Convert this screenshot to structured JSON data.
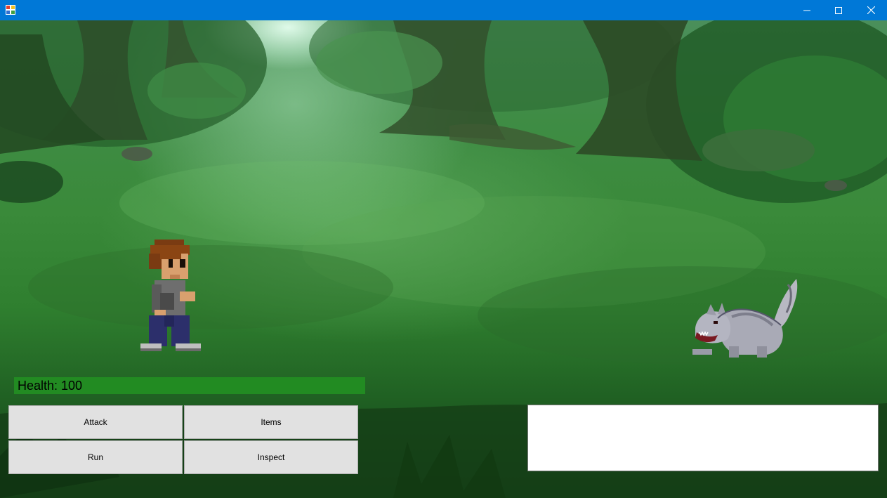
{
  "window": {
    "icon": "app-icon",
    "controls": [
      "minimize-icon",
      "maximize-icon",
      "close-icon"
    ]
  },
  "scene": {
    "background": "forest-clearing",
    "player": "player-character",
    "enemy": "wolf-enemy"
  },
  "player": {
    "health_text": "Health: 100",
    "health_bar_color": "#228b22",
    "health_percent": 100
  },
  "actions": {
    "attack_label": "Attack",
    "items_label": "Items",
    "run_label": "Run",
    "inspect_label": "Inspect"
  },
  "message_log": {
    "text": ""
  },
  "colors": {
    "titlebar": "#0078d7",
    "button_face": "#e1e1e1"
  }
}
